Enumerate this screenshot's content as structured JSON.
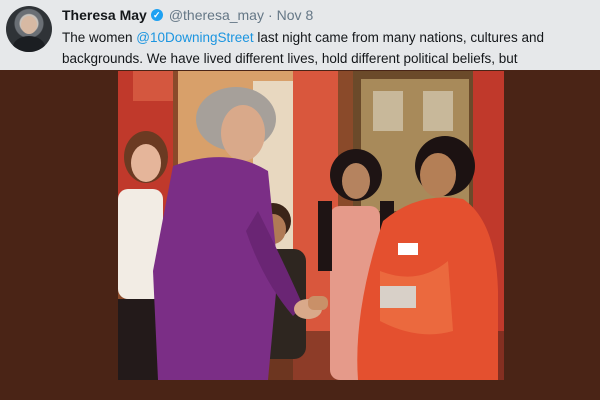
{
  "tweet": {
    "author_name": "Theresa May",
    "verified_icon": "verified-check-icon",
    "handle": "@theresa_may",
    "separator": "·",
    "date": "Nov 8",
    "text_line1_before": "The women ",
    "mention": "@10DowningStreet",
    "text_line1_after": " last night came from many nations, cultures and",
    "text_line2": "backgrounds. We have lived different lives, hold different political beliefs, but"
  },
  "colors": {
    "background": "#4a2416",
    "header_background": "#e6e8ea",
    "mention": "#1b95e0",
    "verified": "#1da1f2"
  }
}
